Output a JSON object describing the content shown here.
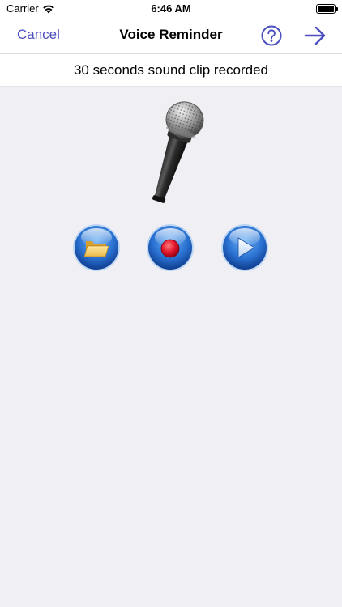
{
  "status_bar": {
    "carrier": "Carrier",
    "time": "6:46 AM",
    "wifi_icon": "wifi-icon",
    "battery_icon": "battery-icon"
  },
  "nav": {
    "cancel_label": "Cancel",
    "title": "Voice Reminder",
    "help_icon": "question-circle-icon",
    "next_icon": "arrow-right-icon"
  },
  "message": "30 seconds sound clip recorded",
  "controls": [
    {
      "name": "open-button",
      "icon": "folder-icon"
    },
    {
      "name": "record-button",
      "icon": "record-icon"
    },
    {
      "name": "play-button",
      "icon": "play-icon"
    }
  ],
  "colors": {
    "accent": "#4b4fbf",
    "background": "#efeff4",
    "button_blue": "#1f63c7",
    "record_red": "#e0142a"
  }
}
